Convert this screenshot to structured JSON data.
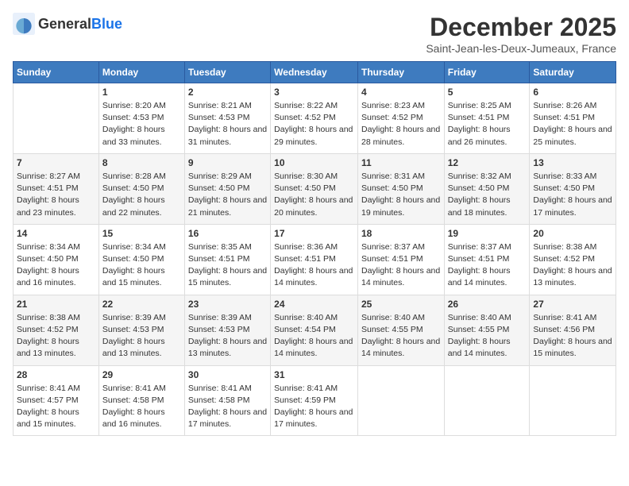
{
  "header": {
    "logo_general": "General",
    "logo_blue": "Blue",
    "month": "December 2025",
    "location": "Saint-Jean-les-Deux-Jumeaux, France"
  },
  "days_of_week": [
    "Sunday",
    "Monday",
    "Tuesday",
    "Wednesday",
    "Thursday",
    "Friday",
    "Saturday"
  ],
  "weeks": [
    [
      {
        "day": "",
        "sunrise": "",
        "sunset": "",
        "daylight": ""
      },
      {
        "day": "1",
        "sunrise": "Sunrise: 8:20 AM",
        "sunset": "Sunset: 4:53 PM",
        "daylight": "Daylight: 8 hours and 33 minutes."
      },
      {
        "day": "2",
        "sunrise": "Sunrise: 8:21 AM",
        "sunset": "Sunset: 4:53 PM",
        "daylight": "Daylight: 8 hours and 31 minutes."
      },
      {
        "day": "3",
        "sunrise": "Sunrise: 8:22 AM",
        "sunset": "Sunset: 4:52 PM",
        "daylight": "Daylight: 8 hours and 29 minutes."
      },
      {
        "day": "4",
        "sunrise": "Sunrise: 8:23 AM",
        "sunset": "Sunset: 4:52 PM",
        "daylight": "Daylight: 8 hours and 28 minutes."
      },
      {
        "day": "5",
        "sunrise": "Sunrise: 8:25 AM",
        "sunset": "Sunset: 4:51 PM",
        "daylight": "Daylight: 8 hours and 26 minutes."
      },
      {
        "day": "6",
        "sunrise": "Sunrise: 8:26 AM",
        "sunset": "Sunset: 4:51 PM",
        "daylight": "Daylight: 8 hours and 25 minutes."
      }
    ],
    [
      {
        "day": "7",
        "sunrise": "Sunrise: 8:27 AM",
        "sunset": "Sunset: 4:51 PM",
        "daylight": "Daylight: 8 hours and 23 minutes."
      },
      {
        "day": "8",
        "sunrise": "Sunrise: 8:28 AM",
        "sunset": "Sunset: 4:50 PM",
        "daylight": "Daylight: 8 hours and 22 minutes."
      },
      {
        "day": "9",
        "sunrise": "Sunrise: 8:29 AM",
        "sunset": "Sunset: 4:50 PM",
        "daylight": "Daylight: 8 hours and 21 minutes."
      },
      {
        "day": "10",
        "sunrise": "Sunrise: 8:30 AM",
        "sunset": "Sunset: 4:50 PM",
        "daylight": "Daylight: 8 hours and 20 minutes."
      },
      {
        "day": "11",
        "sunrise": "Sunrise: 8:31 AM",
        "sunset": "Sunset: 4:50 PM",
        "daylight": "Daylight: 8 hours and 19 minutes."
      },
      {
        "day": "12",
        "sunrise": "Sunrise: 8:32 AM",
        "sunset": "Sunset: 4:50 PM",
        "daylight": "Daylight: 8 hours and 18 minutes."
      },
      {
        "day": "13",
        "sunrise": "Sunrise: 8:33 AM",
        "sunset": "Sunset: 4:50 PM",
        "daylight": "Daylight: 8 hours and 17 minutes."
      }
    ],
    [
      {
        "day": "14",
        "sunrise": "Sunrise: 8:34 AM",
        "sunset": "Sunset: 4:50 PM",
        "daylight": "Daylight: 8 hours and 16 minutes."
      },
      {
        "day": "15",
        "sunrise": "Sunrise: 8:34 AM",
        "sunset": "Sunset: 4:50 PM",
        "daylight": "Daylight: 8 hours and 15 minutes."
      },
      {
        "day": "16",
        "sunrise": "Sunrise: 8:35 AM",
        "sunset": "Sunset: 4:51 PM",
        "daylight": "Daylight: 8 hours and 15 minutes."
      },
      {
        "day": "17",
        "sunrise": "Sunrise: 8:36 AM",
        "sunset": "Sunset: 4:51 PM",
        "daylight": "Daylight: 8 hours and 14 minutes."
      },
      {
        "day": "18",
        "sunrise": "Sunrise: 8:37 AM",
        "sunset": "Sunset: 4:51 PM",
        "daylight": "Daylight: 8 hours and 14 minutes."
      },
      {
        "day": "19",
        "sunrise": "Sunrise: 8:37 AM",
        "sunset": "Sunset: 4:51 PM",
        "daylight": "Daylight: 8 hours and 14 minutes."
      },
      {
        "day": "20",
        "sunrise": "Sunrise: 8:38 AM",
        "sunset": "Sunset: 4:52 PM",
        "daylight": "Daylight: 8 hours and 13 minutes."
      }
    ],
    [
      {
        "day": "21",
        "sunrise": "Sunrise: 8:38 AM",
        "sunset": "Sunset: 4:52 PM",
        "daylight": "Daylight: 8 hours and 13 minutes."
      },
      {
        "day": "22",
        "sunrise": "Sunrise: 8:39 AM",
        "sunset": "Sunset: 4:53 PM",
        "daylight": "Daylight: 8 hours and 13 minutes."
      },
      {
        "day": "23",
        "sunrise": "Sunrise: 8:39 AM",
        "sunset": "Sunset: 4:53 PM",
        "daylight": "Daylight: 8 hours and 13 minutes."
      },
      {
        "day": "24",
        "sunrise": "Sunrise: 8:40 AM",
        "sunset": "Sunset: 4:54 PM",
        "daylight": "Daylight: 8 hours and 14 minutes."
      },
      {
        "day": "25",
        "sunrise": "Sunrise: 8:40 AM",
        "sunset": "Sunset: 4:55 PM",
        "daylight": "Daylight: 8 hours and 14 minutes."
      },
      {
        "day": "26",
        "sunrise": "Sunrise: 8:40 AM",
        "sunset": "Sunset: 4:55 PM",
        "daylight": "Daylight: 8 hours and 14 minutes."
      },
      {
        "day": "27",
        "sunrise": "Sunrise: 8:41 AM",
        "sunset": "Sunset: 4:56 PM",
        "daylight": "Daylight: 8 hours and 15 minutes."
      }
    ],
    [
      {
        "day": "28",
        "sunrise": "Sunrise: 8:41 AM",
        "sunset": "Sunset: 4:57 PM",
        "daylight": "Daylight: 8 hours and 15 minutes."
      },
      {
        "day": "29",
        "sunrise": "Sunrise: 8:41 AM",
        "sunset": "Sunset: 4:58 PM",
        "daylight": "Daylight: 8 hours and 16 minutes."
      },
      {
        "day": "30",
        "sunrise": "Sunrise: 8:41 AM",
        "sunset": "Sunset: 4:58 PM",
        "daylight": "Daylight: 8 hours and 17 minutes."
      },
      {
        "day": "31",
        "sunrise": "Sunrise: 8:41 AM",
        "sunset": "Sunset: 4:59 PM",
        "daylight": "Daylight: 8 hours and 17 minutes."
      },
      {
        "day": "",
        "sunrise": "",
        "sunset": "",
        "daylight": ""
      },
      {
        "day": "",
        "sunrise": "",
        "sunset": "",
        "daylight": ""
      },
      {
        "day": "",
        "sunrise": "",
        "sunset": "",
        "daylight": ""
      }
    ]
  ]
}
